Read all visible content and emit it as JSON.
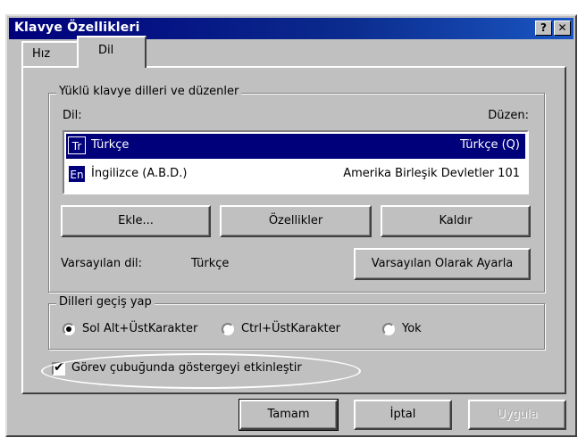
{
  "window": {
    "title": "Klavye Özellikleri",
    "help_button": "?",
    "close_button": "✕"
  },
  "tabs": [
    {
      "label": "Hız",
      "active": false
    },
    {
      "label": "Dil",
      "active": true
    }
  ],
  "layouts_group": {
    "legend": "Yüklü klavye dilleri ve düzenler",
    "col_lang": "Dil:",
    "col_layout": "Düzen:",
    "items": [
      {
        "code": "Tr",
        "name": "Türkçe",
        "layout": "Türkçe (Q)",
        "selected": true
      },
      {
        "code": "En",
        "name": "İngilizce (A.B.D.)",
        "layout": "Amerika Birleşik Devletler 101",
        "selected": false
      }
    ],
    "buttons": {
      "add": "Ekle...",
      "properties": "Özellikler",
      "remove": "Kaldır"
    },
    "default_label": "Varsayılan dil:",
    "default_value": "Türkçe",
    "set_default_button": "Varsayılan Olarak Ayarla"
  },
  "switch_group": {
    "legend": "Dilleri geçiş yap",
    "options": [
      {
        "label": "Sol Alt+ÜstKarakter",
        "checked": true
      },
      {
        "label": "Ctrl+ÜstKarakter",
        "checked": false
      },
      {
        "label": "Yok",
        "checked": false
      }
    ]
  },
  "indicator_checkbox": {
    "label": "Görev çubuğunda göstergeyi etkinleştir",
    "checked": true
  },
  "footer": {
    "ok": "Tamam",
    "cancel": "İptal",
    "apply": "Uygula"
  }
}
